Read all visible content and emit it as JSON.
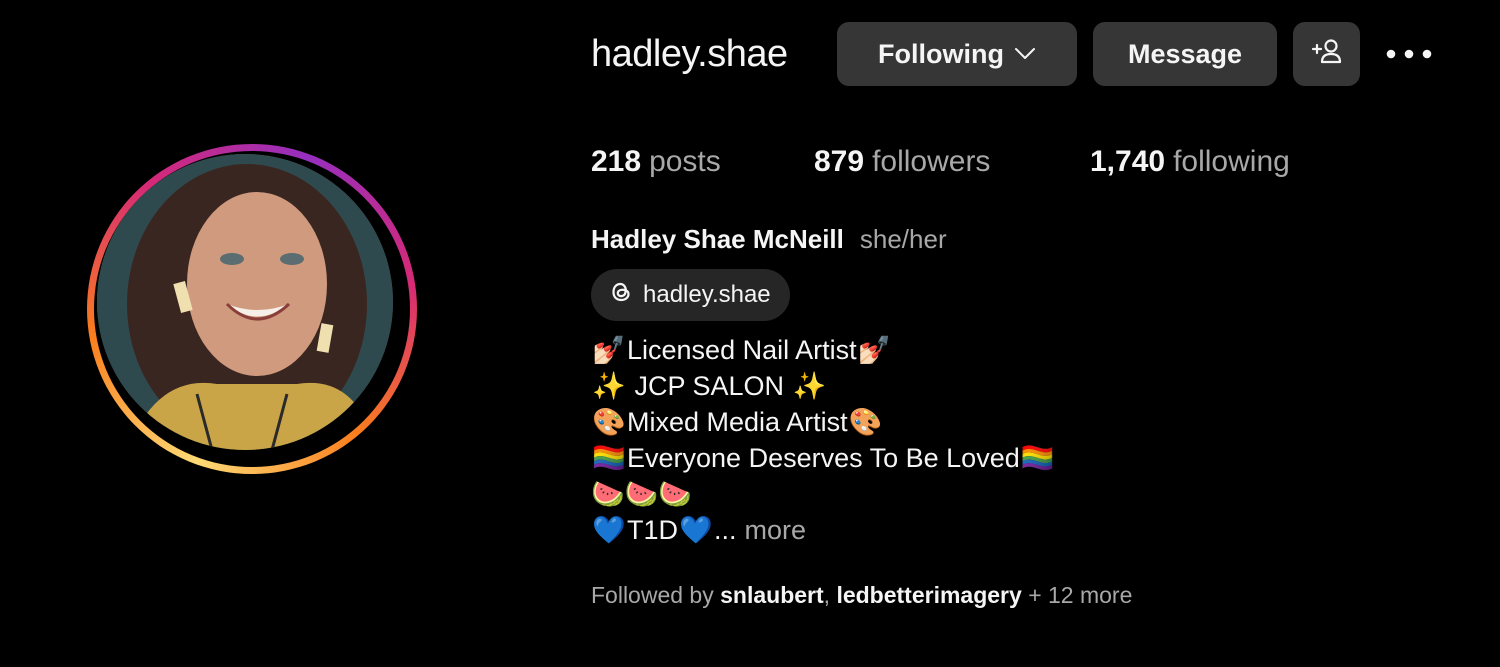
{
  "profile": {
    "username": "hadley.shae",
    "full_name": "Hadley Shae McNeill",
    "pronouns": "she/her",
    "threads_handle": "hadley.shae",
    "avatar_ring_colors": [
      "#feda75",
      "#fa7e1e",
      "#d62976",
      "#962fbf"
    ]
  },
  "actions": {
    "following_label": "Following",
    "message_label": "Message",
    "add_user_icon": "person-add-icon",
    "more_icon": "more-horizontal-icon"
  },
  "stats": {
    "posts_count": "218",
    "posts_label": "posts",
    "followers_count": "879",
    "followers_label": "followers",
    "following_count": "1,740",
    "following_label": "following"
  },
  "bio": {
    "line1": {
      "emoji_left": "💅🏻",
      "text": "Licensed Nail Artist",
      "emoji_right": "💅🏻"
    },
    "line2": {
      "emoji_left": "✨",
      "text": " JCP SALON ",
      "emoji_right": "✨"
    },
    "line3": {
      "emoji_left": "🎨",
      "text": "Mixed Media Artist",
      "emoji_right": "🎨"
    },
    "line4": {
      "emoji_left": "🏳️‍🌈",
      "text": "Everyone Deserves To Be Loved",
      "emoji_right": "🏳️‍🌈"
    },
    "line5": {
      "emoji": "🍉🍉🍉"
    },
    "line6": {
      "emoji_left": "💙",
      "text": "T1D",
      "emoji_right": "💙",
      "ellipsis": "...",
      "more_label": "more"
    }
  },
  "followed_by": {
    "prefix": "Followed by",
    "account1": "snlaubert",
    "separator": ",",
    "account2": "ledbetterimagery",
    "suffix": "+ 12 more"
  },
  "colors": {
    "background": "#000000",
    "button_bg": "#363636",
    "chip_bg": "#262626",
    "secondary_text": "#a8a8a8",
    "primary_text": "#f5f5f5"
  }
}
